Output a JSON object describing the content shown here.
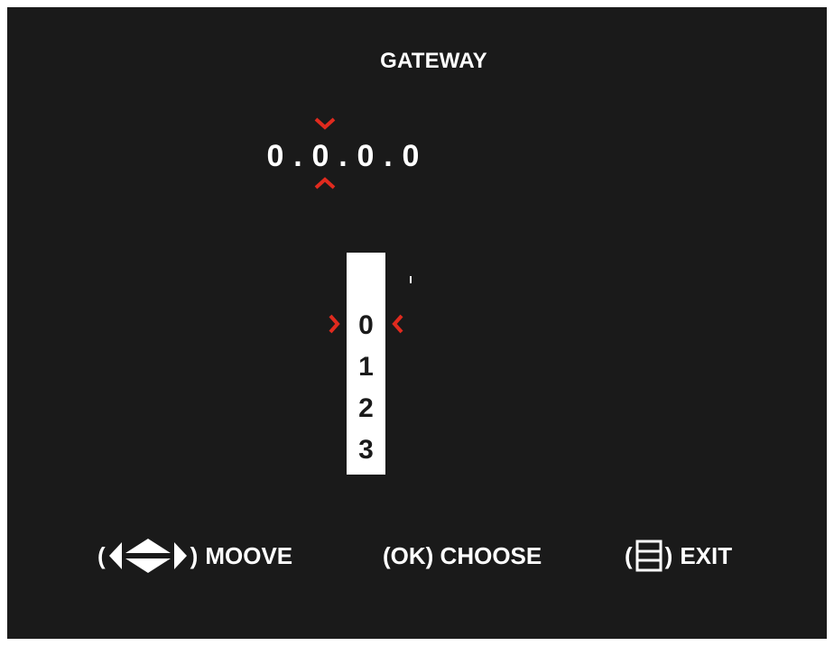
{
  "screen": {
    "title": "GATEWAY"
  },
  "ip_address": {
    "octets": [
      "0",
      "0",
      "0",
      "0"
    ],
    "separator": ".",
    "selected_octet_index": 1
  },
  "picker": {
    "options": [
      "0",
      "1",
      "2",
      "3"
    ],
    "selected": "0"
  },
  "legend": {
    "move": {
      "open": "(",
      "close": ")",
      "label": "MOOVE",
      "icon": "arrows-icon"
    },
    "choose": {
      "label": "(OK) CHOOSE"
    },
    "exit": {
      "open": "(",
      "close": ")",
      "label": "EXIT",
      "icon": "menu-icon"
    }
  },
  "colors": {
    "background": "#1a1a1a",
    "text": "#ffffff",
    "accent": "#e02a1e",
    "picker_bg": "#ffffff",
    "picker_text": "#1a1a1a"
  }
}
